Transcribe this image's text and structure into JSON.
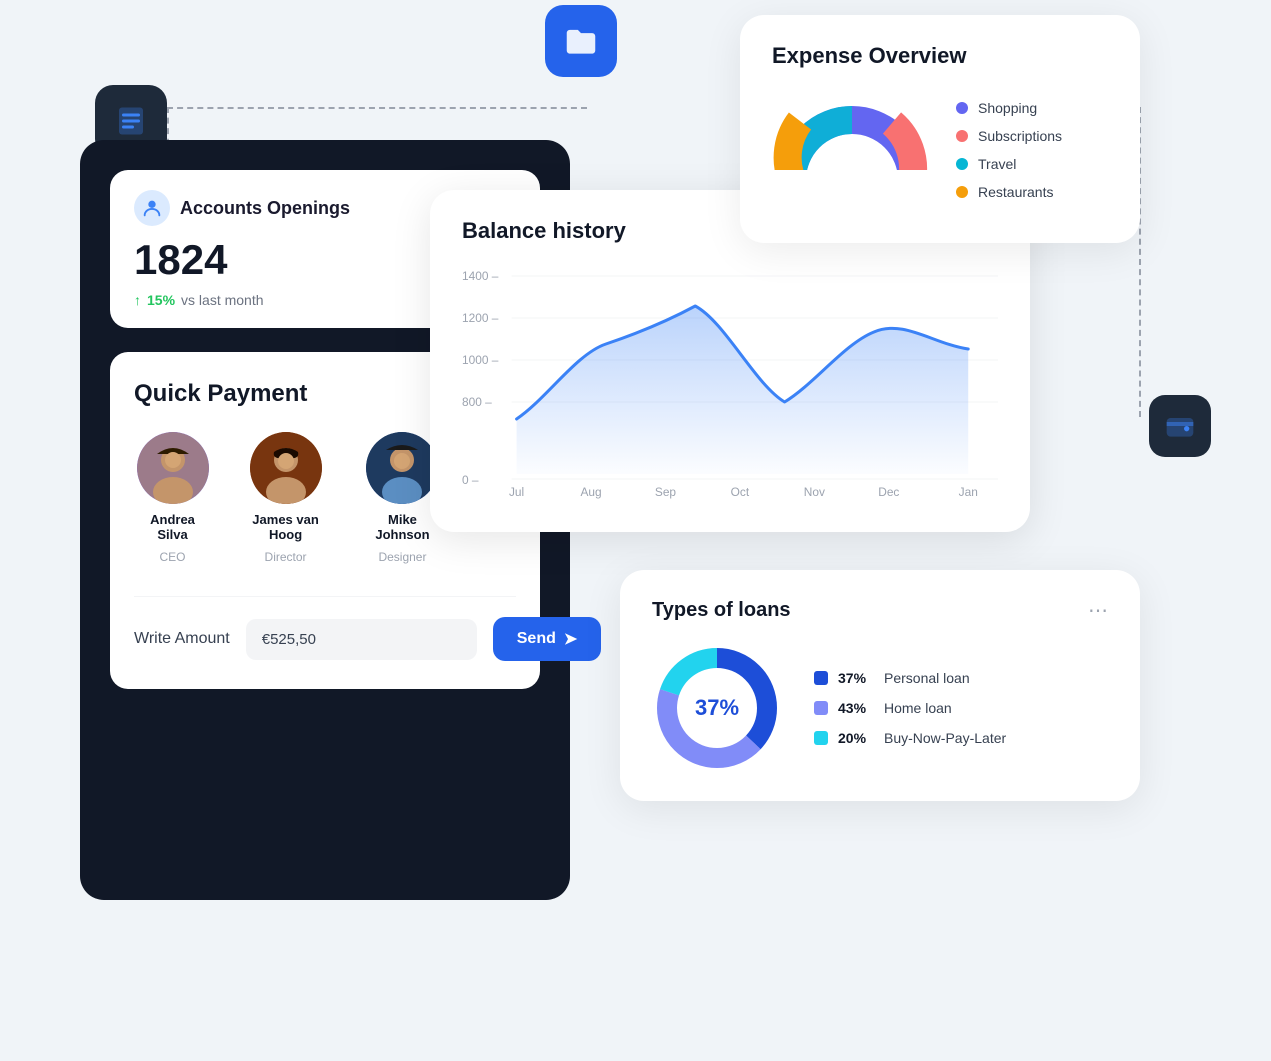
{
  "icons": {
    "doc_icon": "☰",
    "folder_icon": "📁",
    "wallet_icon": "💳"
  },
  "accounts": {
    "title": "Accounts Openings",
    "count": "1824",
    "growth_pct": "15%",
    "growth_label": "vs last month"
  },
  "quick_payment": {
    "title": "Quick Payment",
    "contacts": [
      {
        "name": "Andrea Silva",
        "role": "CEO"
      },
      {
        "name": "James van Hoog",
        "role": "Director"
      },
      {
        "name": "Mike Johnson",
        "role": "Designer"
      }
    ],
    "write_amount_label": "Write Amount",
    "amount_value": "€525,50",
    "send_label": "Send"
  },
  "balance_history": {
    "title": "Balance history",
    "y_labels": [
      "1400",
      "1200",
      "1000",
      "800",
      "0"
    ],
    "x_labels": [
      "Jul",
      "Aug",
      "Sep",
      "Oct",
      "Nov",
      "Dec",
      "Jan"
    ]
  },
  "expense_overview": {
    "title": "Expense Overview",
    "legend": [
      {
        "label": "Shopping",
        "color": "#6366f1"
      },
      {
        "label": "Subscriptions",
        "color": "#f87171"
      },
      {
        "label": "Travel",
        "color": "#06b6d4"
      },
      {
        "label": "Restaurants",
        "color": "#f59e0b"
      }
    ]
  },
  "types_of_loans": {
    "title": "Types of loans",
    "center_pct": "37%",
    "items": [
      {
        "pct": "37%",
        "label": "Personal loan",
        "color": "#1d4ed8"
      },
      {
        "pct": "43%",
        "label": "Home loan",
        "color": "#818cf8"
      },
      {
        "pct": "20%",
        "label": "Buy-Now-Pay-Later",
        "color": "#22d3ee"
      }
    ]
  }
}
